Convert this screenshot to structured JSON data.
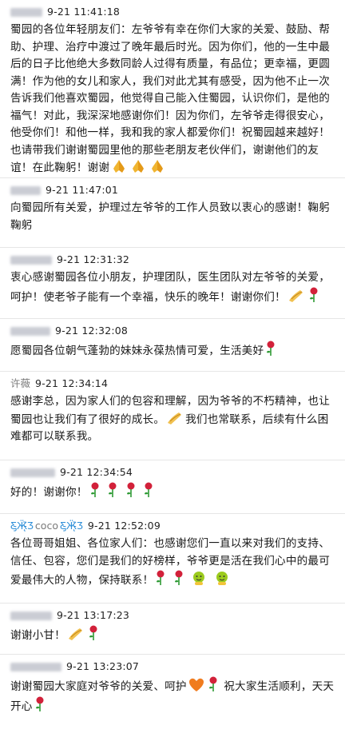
{
  "messages": [
    {
      "name": "",
      "time": "9-21 11:41:18",
      "text": "蜀园的各位年轻朋友们：左爷爷有幸在你们大家的关爱、鼓励、帮助、护理、治疗中渡过了晚年最后时光。因为你们，他的一生中最后的日子比他绝大多数同龄人过得有质量，有品位；更幸福，更圆满！作为他的女儿和家人，我们对此尤其有感受，因为他不止一次告诉我们他喜欢蜀园，他觉得自己能入住蜀园，认识你们，是他的福气！对此，我深深地感谢你们！因为你们，左爷爷走得很安心，他受你们！和他一样，我和我的家人都爱你们！祝蜀园越来越好！也请带我们谢谢蜀园里他的那些老朋友老伙伴们，谢谢他们的友谊！在此鞠躬！谢谢",
      "emoji": [
        "pray",
        "pray",
        "pray"
      ]
    },
    {
      "name": "",
      "time": "9-21 11:47:01",
      "text": "向蜀园所有关爱，护理过左爷爷的工作人员致以衷心的感谢！鞠躬鞠躬",
      "emoji": []
    },
    {
      "name": "",
      "time": "9-21 12:31:32",
      "text": "衷心感谢蜀园各位小朋友，护理团队，医生团队对左爷爷的关爱，呵护！使老爷子能有一个幸福，快乐的晚年！谢谢你们！",
      "emoji": [
        "clap",
        "rose"
      ]
    },
    {
      "name": "",
      "time": "9-21 12:32:08",
      "text": "愿蜀园各位朝气蓬勃的妹妹永葆热情可爱，生活美好",
      "emoji": [
        "rose"
      ]
    },
    {
      "name": "许薇",
      "time": "9-21 12:34:14",
      "text": "感谢李总，因为家人们的包容和理解，因为爷爷的不朽精神，也让蜀园也让我们有了很好的成长。",
      "text2": "我们也常联系，后续有什么困难都可以联系我。",
      "emoji": [
        "clap"
      ]
    },
    {
      "name": "",
      "time": "9-21 12:34:54",
      "text": "好的！谢谢你！",
      "emoji": [
        "rose",
        "rose",
        "rose",
        "rose"
      ]
    },
    {
      "name": "coco",
      "time": "9-21 12:52:09",
      "text": "各位哥哥姐姐、各位家人们：也感谢您们一直以来对我们的支持、信任、包容，您们是我们的好榜样，爷爷更是活在我们心中的最可爱最伟大的人物，保持联系！",
      "emoji": [
        "rose",
        "rose",
        "face",
        "face"
      ]
    },
    {
      "name": "",
      "time": "9-21 13:17:23",
      "text": "谢谢小甘！",
      "emoji": [
        "clap",
        "rose"
      ]
    },
    {
      "name": "",
      "time": "9-21 13:23:07",
      "text": "谢谢蜀园大家庭对爷爷的关爱、呵护",
      "text2": "祝大家生活顺利，天天开心",
      "emoji": [
        "heart",
        "rose",
        "rose"
      ]
    }
  ],
  "colors": {
    "rose": "#d2213a",
    "leaf": "#2e9a34",
    "pray": "#e9a92a",
    "heart": "#f07c1f",
    "face": "#9ccb1e"
  }
}
